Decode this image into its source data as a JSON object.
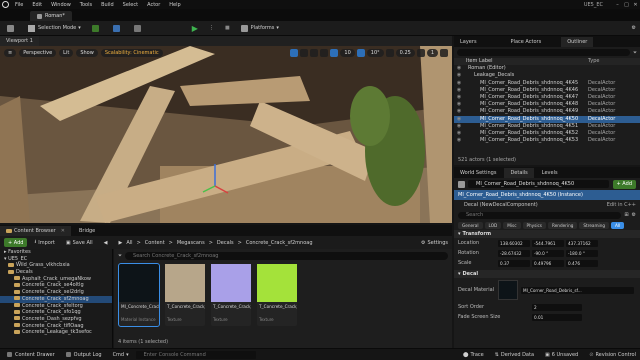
{
  "menu": [
    "File",
    "Edit",
    "Window",
    "Tools",
    "Build",
    "Select",
    "Actor",
    "Help"
  ],
  "project_name": "UE5_EC",
  "level_tab": "Roman*",
  "toolbar": {
    "selection_mode": "Selection Mode",
    "platforms": "Platforms"
  },
  "viewport": {
    "tab": "Viewport 1",
    "perspective": "Perspective",
    "lit": "Lit",
    "show": "Show",
    "scalability": "Scalability: Cinematic",
    "grid_value": "10",
    "rot_value": "10°",
    "scale_value": "0.25",
    "cam_speed": "1"
  },
  "outliner": {
    "tabs": [
      "Layers",
      "Place Actors",
      "Outliner"
    ],
    "header_label": "Item Label",
    "header_type": "Type",
    "rows": [
      {
        "label": "Roman (Editor)",
        "type": "",
        "indent": 0,
        "selected": false
      },
      {
        "label": "Leakage_Decals",
        "type": "",
        "indent": 1,
        "selected": false
      },
      {
        "label": "MI_Corner_Road_Debris_shdnnoq_4K45",
        "type": "DecalActor",
        "indent": 2,
        "selected": false
      },
      {
        "label": "MI_Corner_Road_Debris_shdnnoq_4K46",
        "type": "DecalActor",
        "indent": 2,
        "selected": false
      },
      {
        "label": "MI_Corner_Road_Debris_shdnnoq_4K47",
        "type": "DecalActor",
        "indent": 2,
        "selected": false
      },
      {
        "label": "MI_Corner_Road_Debris_shdnnoq_4K48",
        "type": "DecalActor",
        "indent": 2,
        "selected": false
      },
      {
        "label": "MI_Corner_Road_Debris_shdnnoq_4K49",
        "type": "DecalActor",
        "indent": 2,
        "selected": false
      },
      {
        "label": "MI_Corner_Road_Debris_shdnnoq_4K50",
        "type": "DecalActor",
        "indent": 2,
        "selected": true
      },
      {
        "label": "MI_Corner_Road_Debris_shdnnoq_4K51",
        "type": "DecalActor",
        "indent": 2,
        "selected": false
      },
      {
        "label": "MI_Corner_Road_Debris_shdnnoq_4K52",
        "type": "DecalActor",
        "indent": 2,
        "selected": false
      },
      {
        "label": "MI_Corner_Road_Debris_shdnnoq_4K53",
        "type": "DecalActor",
        "indent": 2,
        "selected": false
      }
    ],
    "count": "521 actors (1 selected)"
  },
  "details": {
    "tabs": [
      "World Settings",
      "Details",
      "Levels"
    ],
    "actor_name": "MI_Corner_Road_Debris_shdnnoq_4K50",
    "add_label": "+ Add",
    "instance": "MI_Corner_Road_Debris_shdnnoq_4K50 (Instance)",
    "component": "Decal (NewDecalComponent)",
    "edit_cpp": "Edit in C++",
    "search_placeholder": "Search",
    "filters": [
      "General",
      "LOD",
      "Misc",
      "Physics",
      "Rendering",
      "Streaming",
      "All"
    ],
    "active_filter": "All",
    "transform_header": "Transform",
    "location_label": "Location",
    "location": [
      "138.60302",
      "-544.7961",
      "437.37162"
    ],
    "rotation_label": "Rotation",
    "rotation": [
      "-28.67432",
      "-90.0 °",
      "-180.0 °"
    ],
    "scale_label": "Scale",
    "scale": [
      "0.37",
      "0.49796",
      "0.476"
    ],
    "decal_header": "Decal",
    "decal_material_label": "Decal Material",
    "decal_material_value": "MI_Corner_Road_Debris_sf...",
    "sort_order_label": "Sort Order",
    "sort_order_value": "2",
    "fade_label": "Fade Screen Size",
    "fade_value": "0.01"
  },
  "content_browser": {
    "tabs": [
      "Content Browser",
      "Bridge"
    ],
    "add": "+ Add",
    "import": "Import",
    "save_all": "Save All",
    "path": [
      "All",
      ">",
      "Content",
      ">",
      "Megascans",
      ">",
      "Decals",
      ">",
      "Concrete_Crack_sf2mnoag"
    ],
    "settings": "Settings",
    "favorites": "Favorites",
    "project": "UE5_EC",
    "tree": [
      {
        "label": "Wild_Grass_vlkhcbxia",
        "sel": false
      },
      {
        "label": "Decals",
        "sel": false
      },
      {
        "label": "Asphalt_Crack_umegaNkow",
        "sel": false
      },
      {
        "label": "Concrete_Crack_se4oltlg",
        "sel": false
      },
      {
        "label": "Concrete_Crack_sel2drlg",
        "sel": false
      },
      {
        "label": "Concrete_Crack_sf2mnoag",
        "sel": true
      },
      {
        "label": "Concrete_Crack_sfeltorg",
        "sel": false
      },
      {
        "label": "Concrete_Crack_sfo1qg",
        "sel": false
      },
      {
        "label": "Concrete_Dash_sezpfvg",
        "sel": false
      },
      {
        "label": "Concrete_Crack_tiflOaag",
        "sel": false
      },
      {
        "label": "Concrete_Leakage_tk3sefoc",
        "sel": false
      }
    ],
    "search_placeholder": "Search Concrete_Crack_sf2mnoag",
    "assets": [
      {
        "name": "MI_Concrete_Crack_sf2mnoag_4K",
        "type": "Material Instance",
        "color": "#0d1418",
        "sel": true
      },
      {
        "name": "T_Concrete_Crack_sf2mnoag_4K_D",
        "type": "Texture",
        "color": "#b7a68a",
        "sel": false
      },
      {
        "name": "T_Concrete_Crack_sf2mnoag_4K_N",
        "type": "Texture",
        "color": "#a9a0e8",
        "sel": false
      },
      {
        "name": "T_Concrete_Crack_sf2mnoag_4K_ORM",
        "type": "Texture",
        "color": "#a4e23a",
        "sel": false
      }
    ],
    "count": "4 items (1 selected)"
  },
  "status": {
    "content_drawer": "Content Drawer",
    "output_log": "Output Log",
    "cmd": "Cmd",
    "console_placeholder": "Enter Console Command",
    "trace": "Trace",
    "derived": "Derived Data",
    "unsaved": "6 Unsaved",
    "revision": "Revision Control"
  },
  "accent_colors": {
    "selection": "#2d5d92",
    "play": "#3eb34f",
    "add": "#3d7a2a",
    "scalability": "#f0b040"
  }
}
